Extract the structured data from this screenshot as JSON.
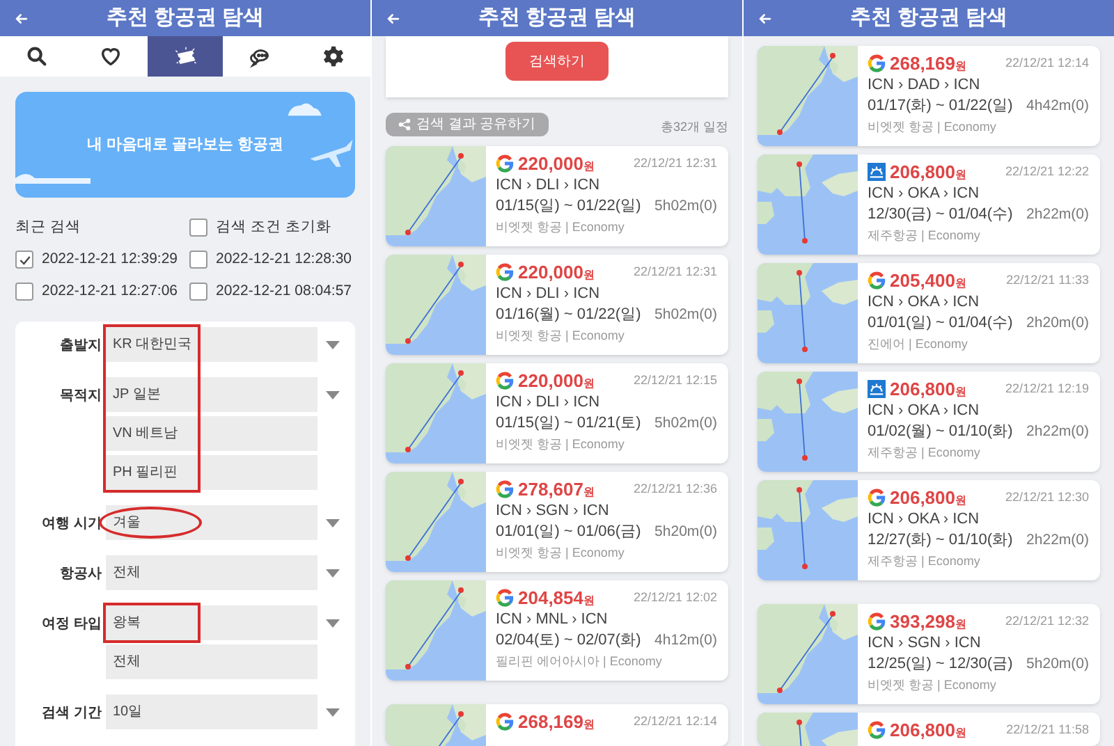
{
  "panels": [
    {
      "header": {
        "title": "추천 항공권 탐색"
      },
      "tabs": [
        {
          "kind": "search",
          "selected": false
        },
        {
          "kind": "heart",
          "selected": false
        },
        {
          "kind": "ticket",
          "selected": true
        },
        {
          "kind": "chat",
          "selected": false
        },
        {
          "kind": "gear",
          "selected": false
        }
      ],
      "banner": {
        "text": "내 마음대로 골라보는 항공권"
      },
      "recent": {
        "title": "최근 검색",
        "reset": {
          "label": "검색 조건 초기화",
          "checked": false
        },
        "items": [
          {
            "label": "2022-12-21 12:39:29",
            "checked": true
          },
          {
            "label": "2022-12-21 12:28:30",
            "checked": false
          },
          {
            "label": "2022-12-21 12:27:06",
            "checked": false
          },
          {
            "label": "2022-12-21 08:04:57",
            "checked": false
          }
        ]
      },
      "form": [
        {
          "label": "출발지",
          "values": [
            {
              "text": "KR 대한민국",
              "annotation": {
                "kind": "box"
              }
            }
          ]
        },
        {
          "label": "목적지",
          "values": [
            {
              "text": "JP 일본",
              "annotation": {
                "kind": "box"
              }
            },
            {
              "text": "VN 베트남",
              "annotation": {
                "kind": "box"
              }
            },
            {
              "text": "PH 필리핀",
              "annotation": {
                "kind": "box"
              }
            }
          ]
        },
        {
          "label": "여행 시기",
          "values": [
            {
              "text": "겨울",
              "annotation": {
                "kind": "ellipse"
              }
            }
          ]
        },
        {
          "label": "항공사",
          "values": [
            {
              "text": "전체"
            }
          ]
        },
        {
          "label": "여정 타입",
          "values": [
            {
              "text": "왕복",
              "annotation": {
                "kind": "box"
              }
            },
            {
              "text": "전체"
            }
          ]
        },
        {
          "label": "검색 기간",
          "values": [
            {
              "text": "10일"
            }
          ]
        }
      ]
    },
    {
      "header": {
        "title": "추천 항공권 탐색"
      },
      "search_button": "검색하기",
      "share_button": "검색 결과 공유하기",
      "total": "총32개 일정",
      "groups": [
        [
          {
            "logo": {
              "kind": "google"
            },
            "map": {
              "kind": "wide"
            },
            "price": "220,000",
            "unit": "원",
            "time": "22/12/21 12:31",
            "route": "ICN › DLI › ICN",
            "dates": "01/15(일) ~ 01/22(일)",
            "duration": "5h02m(0)",
            "airline": "비엣젯 항공 | Economy"
          },
          {
            "logo": {
              "kind": "google"
            },
            "map": {
              "kind": "wide"
            },
            "price": "220,000",
            "unit": "원",
            "time": "22/12/21 12:31",
            "route": "ICN › DLI › ICN",
            "dates": "01/16(월) ~ 01/22(일)",
            "duration": "5h02m(0)",
            "airline": "비엣젯 항공 | Economy"
          },
          {
            "logo": {
              "kind": "google"
            },
            "map": {
              "kind": "wide"
            },
            "price": "220,000",
            "unit": "원",
            "time": "22/12/21 12:15",
            "route": "ICN › DLI › ICN",
            "dates": "01/15(일) ~ 01/21(토)",
            "duration": "5h02m(0)",
            "airline": "비엣젯 항공 | Economy"
          },
          {
            "logo": {
              "kind": "google"
            },
            "map": {
              "kind": "wide"
            },
            "price": "278,607",
            "unit": "원",
            "time": "22/12/21 12:36",
            "route": "ICN › SGN › ICN",
            "dates": "01/01(일) ~ 01/06(금)",
            "duration": "5h20m(0)",
            "airline": "비엣젯 항공 | Economy"
          },
          {
            "logo": {
              "kind": "google"
            },
            "map": {
              "kind": "wide"
            },
            "price": "204,854",
            "unit": "원",
            "time": "22/12/21 12:02",
            "route": "ICN › MNL › ICN",
            "dates": "02/04(토) ~ 02/07(화)",
            "duration": "4h12m(0)",
            "airline": "필리핀 에어아시아 | Economy"
          }
        ],
        [
          {
            "logo": {
              "kind": "google"
            },
            "map": {
              "kind": "wide"
            },
            "price": "268,169",
            "unit": "원",
            "time": "22/12/21 12:14"
          }
        ]
      ]
    },
    {
      "header": {
        "title": "추천 항공권 탐색"
      },
      "groups": [
        [
          {
            "logo": {
              "kind": "google"
            },
            "map": {
              "kind": "wide"
            },
            "price": "268,169",
            "unit": "원",
            "time": "22/12/21 12:14",
            "route": "ICN › DAD › ICN",
            "dates": "01/17(화) ~ 01/22(일)",
            "duration": "4h42m(0)",
            "airline": "비엣젯 항공 | Economy"
          },
          {
            "logo": {
              "kind": "jeju"
            },
            "map": {
              "kind": "close"
            },
            "price": "206,800",
            "unit": "원",
            "time": "22/12/21 12:22",
            "route": "ICN › OKA › ICN",
            "dates": "12/30(금) ~ 01/04(수)",
            "duration": "2h22m(0)",
            "airline": "제주항공 | Economy"
          },
          {
            "logo": {
              "kind": "google"
            },
            "map": {
              "kind": "close"
            },
            "price": "205,400",
            "unit": "원",
            "time": "22/12/21 11:33",
            "route": "ICN › OKA › ICN",
            "dates": "01/01(일) ~ 01/04(수)",
            "duration": "2h20m(0)",
            "airline": "진에어 | Economy"
          },
          {
            "logo": {
              "kind": "jeju"
            },
            "map": {
              "kind": "close"
            },
            "price": "206,800",
            "unit": "원",
            "time": "22/12/21 12:19",
            "route": "ICN › OKA › ICN",
            "dates": "01/02(월) ~ 01/10(화)",
            "duration": "2h22m(0)",
            "airline": "제주항공 | Economy"
          },
          {
            "logo": {
              "kind": "google"
            },
            "map": {
              "kind": "close"
            },
            "price": "206,800",
            "unit": "원",
            "time": "22/12/21 12:30",
            "route": "ICN › OKA › ICN",
            "dates": "12/27(화) ~ 01/10(화)",
            "duration": "2h22m(0)",
            "airline": "제주항공 | Economy"
          }
        ],
        [
          {
            "logo": {
              "kind": "google"
            },
            "map": {
              "kind": "wide"
            },
            "price": "393,298",
            "unit": "원",
            "time": "22/12/21 12:32",
            "route": "ICN › SGN › ICN",
            "dates": "12/25(일) ~ 12/30(금)",
            "duration": "5h20m(0)",
            "airline": "비엣젯 항공 | Economy"
          },
          {
            "logo": {
              "kind": "google"
            },
            "map": {
              "kind": "close"
            },
            "price": "206,800",
            "unit": "원",
            "time": "22/12/21 11:58"
          }
        ]
      ]
    }
  ]
}
